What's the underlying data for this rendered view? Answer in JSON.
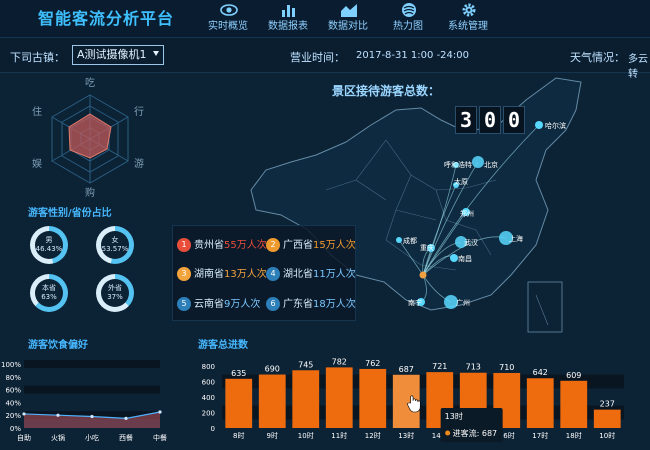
{
  "header": {
    "title": "智能客流分析平台",
    "nav": [
      {
        "label": "实时概览",
        "icon": "eye-icon"
      },
      {
        "label": "数据报表",
        "icon": "bar-chart-icon"
      },
      {
        "label": "数据对比",
        "icon": "area-chart-icon"
      },
      {
        "label": "热力图",
        "icon": "heat-map-icon"
      },
      {
        "label": "系统管理",
        "icon": "gear-icon"
      }
    ]
  },
  "toolbar": {
    "location_label": "下司古镇：",
    "camera_selected": "A测试摄像机1",
    "hours_label": "营业时间：",
    "hours_value": "2017-8-31 1:00 -24:00",
    "weather_label": "天气情况：",
    "weather_value": "多云转"
  },
  "radar": {
    "labels": [
      "吃",
      "行",
      "游",
      "购",
      "娱",
      "住"
    ],
    "values": [
      0.55,
      0.5,
      0.4,
      0.45,
      0.5,
      0.55
    ]
  },
  "gender": {
    "title": "游客性别/省份占比",
    "rings": [
      {
        "label": "男",
        "value": "46.43%",
        "pct": 46.43
      },
      {
        "label": "女",
        "value": "53.57%",
        "pct": 53.57
      },
      {
        "label": "本省",
        "value": "63%",
        "pct": 63
      },
      {
        "label": "外省",
        "value": "37%",
        "pct": 37
      }
    ]
  },
  "map": {
    "title": "景区接待游客总数：",
    "total_digits": [
      "3",
      "0",
      "0"
    ],
    "cities": [
      "哈尔滨",
      "呼和浩特",
      "北京",
      "太原",
      "郑州",
      "成都",
      "重庆",
      "武汉",
      "上海",
      "南昌",
      "南宁",
      "广州"
    ],
    "ranking": [
      {
        "rank": "1",
        "province": "贵州省",
        "value": "55万人次",
        "color": "#e94e3a"
      },
      {
        "rank": "2",
        "province": "广西省",
        "value": "15万人次",
        "color": "#ef9a2c"
      },
      {
        "rank": "3",
        "province": "湖南省",
        "value": "13万人次",
        "color": "#f3a33c"
      },
      {
        "rank": "4",
        "province": "湖北省",
        "value": "11万人次",
        "color": "#2c7fb8"
      },
      {
        "rank": "5",
        "province": "云南省",
        "value": "9万人次",
        "color": "#2c7fb8"
      },
      {
        "rank": "6",
        "province": "广东省",
        "value": "18万人次",
        "color": "#2c7fb8"
      }
    ]
  },
  "diet": {
    "title": "游客饮食偏好",
    "chart_data": {
      "type": "area",
      "categories": [
        "自助",
        "火锅",
        "小吃",
        "西餐",
        "中餐"
      ],
      "values": [
        22,
        20,
        18,
        15,
        25
      ],
      "ylim": [
        0,
        100
      ],
      "yticks": [
        "0%",
        "20%",
        "40%",
        "60%",
        "80%",
        "100%"
      ]
    }
  },
  "traffic": {
    "title": "游客总进数",
    "chart_data": {
      "type": "bar",
      "categories": [
        "8时",
        "9时",
        "10时",
        "11时",
        "12时",
        "13时",
        "14时",
        "15时",
        "16时",
        "17时",
        "18时",
        "10时"
      ],
      "values": [
        635,
        690,
        745,
        782,
        762,
        687,
        721,
        713,
        710,
        642,
        609,
        237
      ],
      "ylim": [
        0,
        800
      ],
      "yticks": [
        "0",
        "200",
        "400",
        "600",
        "800"
      ],
      "highlight_index": 5
    },
    "tooltip": {
      "title": "13时",
      "series_label": "进客流:",
      "series_value": "687"
    }
  }
}
